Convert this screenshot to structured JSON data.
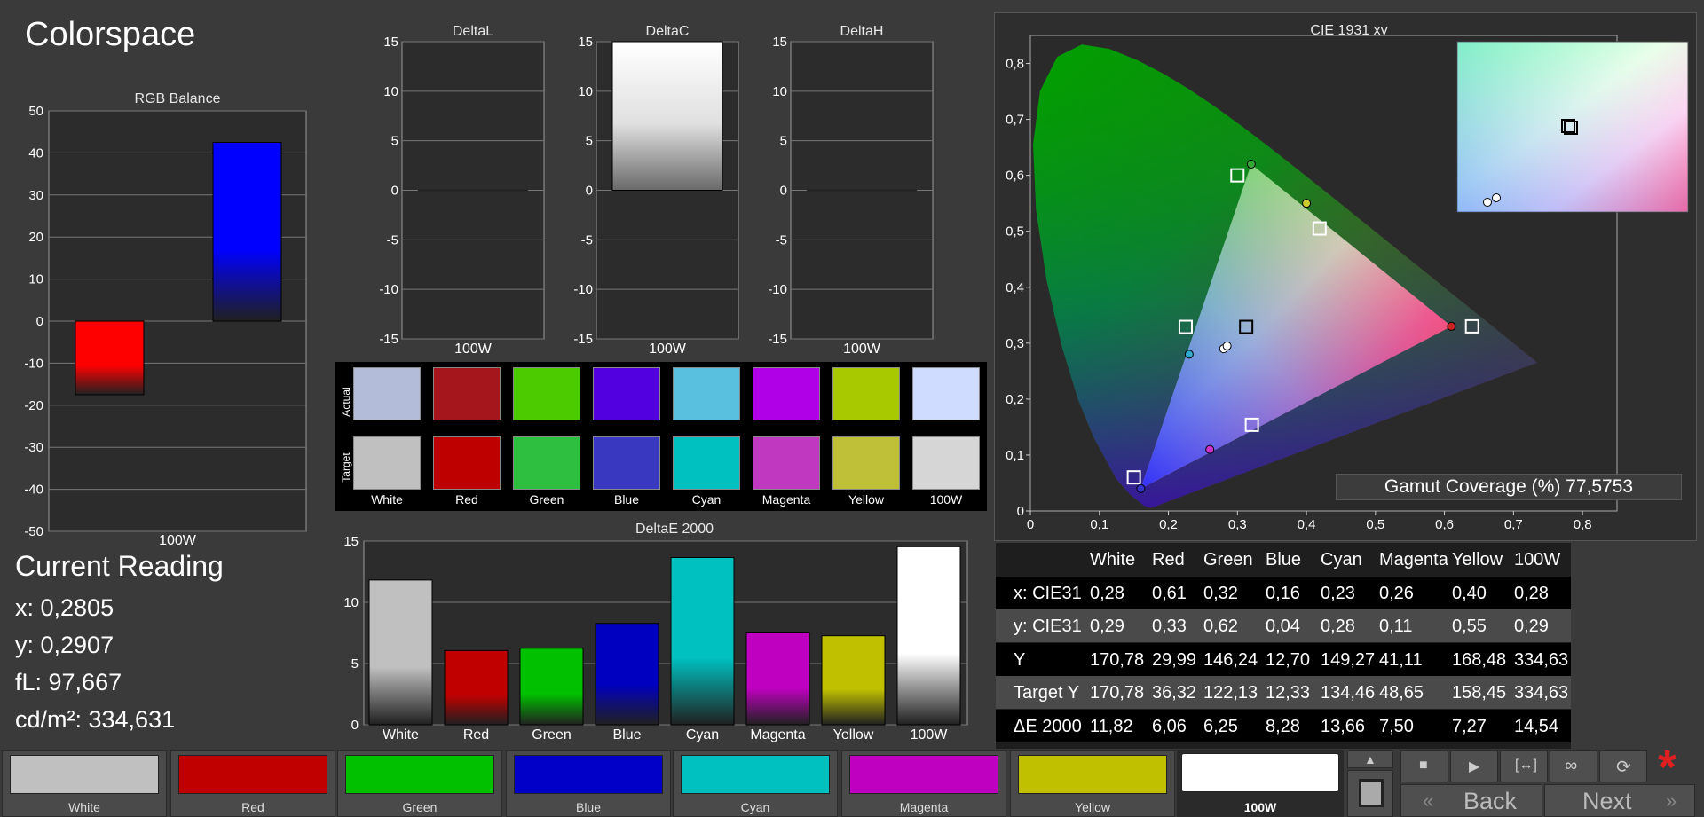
{
  "page_title": "Colorspace",
  "rgb_balance": {
    "title": "RGB Balance",
    "type": "bar",
    "categories": [
      "100W"
    ],
    "series": [
      {
        "values": [
          -17.5
        ],
        "color": "#ff0000"
      },
      {
        "values": [
          42.5
        ],
        "color": "#0000ff"
      }
    ],
    "yticks": [
      "50",
      "40",
      "30",
      "20",
      "10",
      "0",
      "-10",
      "-20",
      "-30",
      "-40",
      "-50"
    ],
    "ylim": [
      -50,
      50
    ]
  },
  "delta_charts": [
    {
      "title": "DeltaL",
      "xlabel": "100W",
      "value": 0,
      "yticks": [
        "15",
        "10",
        "5",
        "0",
        "-5",
        "-10",
        "-15"
      ]
    },
    {
      "title": "DeltaC",
      "xlabel": "100W",
      "value": 15,
      "yticks": [
        "15",
        "10",
        "5",
        "0",
        "-5",
        "-10",
        "-15"
      ]
    },
    {
      "title": "DeltaH",
      "xlabel": "100W",
      "value": 0,
      "yticks": [
        "15",
        "10",
        "5",
        "0",
        "-5",
        "-10",
        "-15"
      ]
    }
  ],
  "swatches": {
    "actual_label": "Actual",
    "target_label": "Target",
    "items": [
      {
        "name": "White",
        "actual": "#b3bcd8",
        "target": "#c0c0c0"
      },
      {
        "name": "Red",
        "actual": "#a5161c",
        "target": "#bf0000"
      },
      {
        "name": "Green",
        "actual": "#4ccc00",
        "target": "#2fbf40"
      },
      {
        "name": "Blue",
        "actual": "#5200e0",
        "target": "#3838c0"
      },
      {
        "name": "Cyan",
        "actual": "#5ac0e0",
        "target": "#00c0c0"
      },
      {
        "name": "Magenta",
        "actual": "#b000e8",
        "target": "#c038c0"
      },
      {
        "name": "Yellow",
        "actual": "#a8c800",
        "target": "#c0c038"
      },
      {
        "name": "100W",
        "actual": "#cfdcff",
        "target": "#d6d6d6"
      }
    ]
  },
  "deltae": {
    "title": "DeltaE 2000",
    "type": "bar",
    "categories": [
      "White",
      "Red",
      "Green",
      "Blue",
      "Cyan",
      "Magenta",
      "Yellow",
      "100W"
    ],
    "values": [
      11.82,
      6.06,
      6.25,
      8.28,
      13.66,
      7.5,
      7.27,
      14.54
    ],
    "colors": [
      "#c0c0c0",
      "#c00000",
      "#00c000",
      "#0000c0",
      "#00c0c0",
      "#c000c0",
      "#c0c000",
      "#ffffff"
    ],
    "yticks": [
      "15",
      "10",
      "5",
      "0"
    ],
    "ylim": [
      0,
      15
    ]
  },
  "current_reading": {
    "title": "Current Reading",
    "x": "x: 0,2805",
    "y": "y: 0,2907",
    "fl": "fL: 97,667",
    "cdm2": "cd/m²: 334,631"
  },
  "cie": {
    "title": "CIE 1931 xy",
    "xticks": [
      "0",
      "0,1",
      "0,2",
      "0,3",
      "0,4",
      "0,5",
      "0,6",
      "0,7",
      "0,8"
    ],
    "yticks": [
      "0,8",
      "0,7",
      "0,6",
      "0,5",
      "0,4",
      "0,3",
      "0,2",
      "0,1",
      "0"
    ],
    "gamut_label": "Gamut Coverage (%) 77,5753",
    "targets": [
      [
        0.64,
        0.33
      ],
      [
        0.3,
        0.6
      ],
      [
        0.15,
        0.06
      ],
      [
        0.3127,
        0.329
      ],
      [
        0.225,
        0.329
      ],
      [
        0.321,
        0.154
      ],
      [
        0.419,
        0.505
      ]
    ],
    "measured": [
      [
        0.61,
        0.33
      ],
      [
        0.32,
        0.62
      ],
      [
        0.16,
        0.04
      ],
      [
        0.28,
        0.29
      ],
      [
        0.23,
        0.28
      ],
      [
        0.26,
        0.11
      ],
      [
        0.4,
        0.55
      ],
      [
        0.285,
        0.295
      ]
    ]
  },
  "table": {
    "headers": [
      "",
      "White",
      "Red",
      "Green",
      "Blue",
      "Cyan",
      "Magenta",
      "Yellow",
      "100W"
    ],
    "rows": [
      {
        "label": "x: CIE31",
        "values": [
          "0,28",
          "0,61",
          "0,32",
          "0,16",
          "0,23",
          "0,26",
          "0,40",
          "0,28"
        ]
      },
      {
        "label": "y: CIE31",
        "values": [
          "0,29",
          "0,33",
          "0,62",
          "0,04",
          "0,28",
          "0,11",
          "0,55",
          "0,29"
        ]
      },
      {
        "label": "Y",
        "values": [
          "170,78",
          "29,99",
          "146,24",
          "12,70",
          "149,27",
          "41,11",
          "168,48",
          "334,63"
        ]
      },
      {
        "label": "Target Y",
        "values": [
          "170,78",
          "36,32",
          "122,13",
          "12,33",
          "134,46",
          "48,65",
          "158,45",
          "334,63"
        ]
      },
      {
        "label": "ΔE 2000",
        "values": [
          "11,82",
          "6,06",
          "6,25",
          "8,28",
          "13,66",
          "7,50",
          "7,27",
          "14,54"
        ]
      }
    ]
  },
  "bottom_buttons": [
    {
      "label": "White",
      "color": "#c0c0c0"
    },
    {
      "label": "Red",
      "color": "#c00000"
    },
    {
      "label": "Green",
      "color": "#00c000"
    },
    {
      "label": "Blue",
      "color": "#0000c8"
    },
    {
      "label": "Cyan",
      "color": "#00c0c0"
    },
    {
      "label": "Magenta",
      "color": "#c000c0"
    },
    {
      "label": "Yellow",
      "color": "#c0c000"
    },
    {
      "label": "100W",
      "color": "#ffffff"
    }
  ],
  "nav": {
    "back": "Back",
    "next": "Next"
  }
}
